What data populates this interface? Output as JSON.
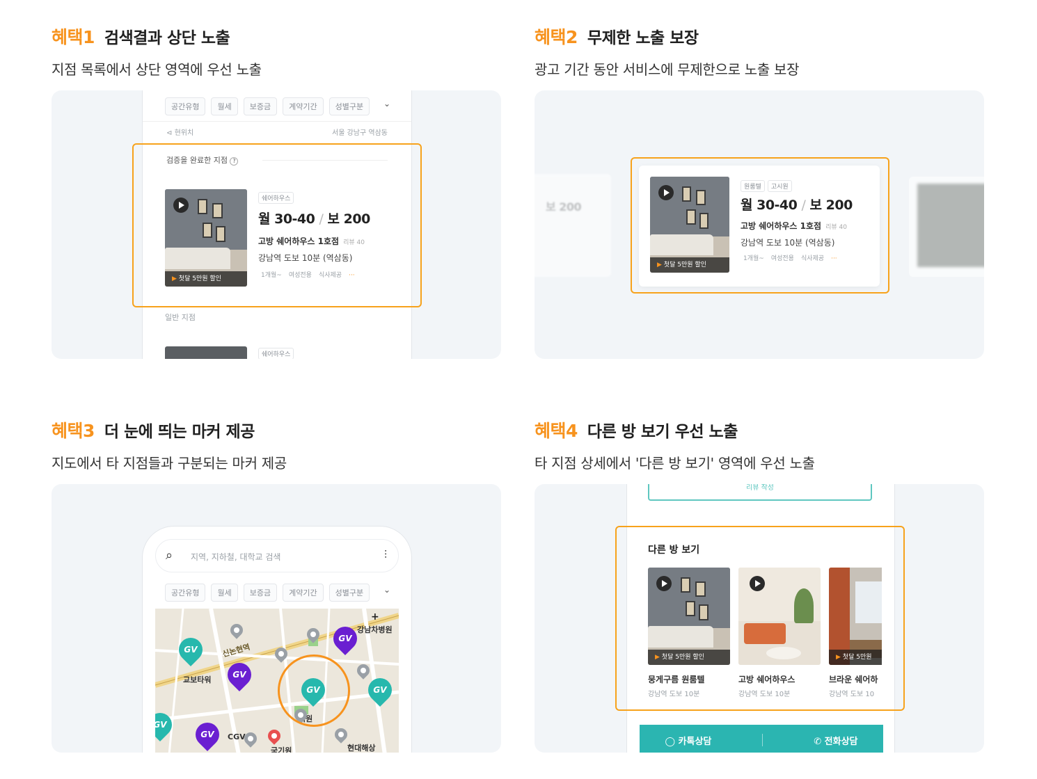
{
  "benefits": [
    {
      "tag": "혜택1",
      "title": "검색결과 상단 노출",
      "desc": "지점 목록에서 상단 영역에 우선 노출"
    },
    {
      "tag": "혜택2",
      "title": "무제한 노출 보장",
      "desc": "광고 기간 동안 서비스에 무제한으로 노출 보장"
    },
    {
      "tag": "혜택3",
      "title": "더 눈에 띄는 마커 제공",
      "desc": "지도에서 타 지점들과 구분되는 마커 제공"
    },
    {
      "tag": "혜택4",
      "title": "다른 방 보기 우선 노출",
      "desc": "타 지점 상세에서 '다른 방 보기' 영역에 우선 노출"
    }
  ],
  "filters": [
    "공간유형",
    "월세",
    "보증금",
    "계약기간",
    "성별구분"
  ],
  "mock_list": {
    "current_location": "현위치",
    "region": "서울 강남구 역삼동",
    "verified_section": "검증을 완료한 지점",
    "general_section": "일반 지점",
    "listing": {
      "badge": "쉐어하우스",
      "price_monthly": "월 30-40",
      "price_deposit": "보 200",
      "name": "고방 쉐어하우스 1호점",
      "reviews": "리뷰 40",
      "location": "강남역 도보 10분 (역삼동)",
      "options": [
        "1개월~",
        "여성전용",
        "식사제공"
      ],
      "promo": "첫달 5만원 할인"
    }
  },
  "mock_card2": {
    "badges": [
      "원룸텔",
      "고시원"
    ],
    "price_monthly": "월 30-40",
    "price_deposit": "보 200",
    "name": "고방 쉐어하우스 1호점",
    "reviews": "리뷰 40",
    "location": "강남역 도보 10분 (역삼동)",
    "options": [
      "1개월~",
      "여성전용",
      "식사제공"
    ],
    "promo": "첫달 5만원 할인",
    "side_price": "보 200"
  },
  "mock_map": {
    "search_placeholder": "지역, 지하철, 대학교 검색",
    "labels": [
      "신논현역",
      "교보타워",
      "강남차병원",
      "CGV",
      "기원",
      "현대해상",
      "국기원"
    ],
    "pin_text": "GV"
  },
  "mock_detail": {
    "review_button": "리뷰 작성",
    "section_title": "다른 방 보기",
    "rooms": [
      {
        "name": "뭉게구름 원룸텔",
        "sub": "강남역 도보 10분",
        "promo": "첫달 5만원 할인"
      },
      {
        "name": "고방 쉐어하우스",
        "sub": "강남역 도보 10분",
        "promo": ""
      },
      {
        "name": "브라운 쉐어하",
        "sub": "강남역 도보 10",
        "promo": "첫달 5만원"
      }
    ],
    "kakao_button": "카톡상담",
    "call_button": "전화상담"
  },
  "colors": {
    "accent": "#f7931e",
    "highlight": "#f7a21b",
    "teal": "#2bb5b1",
    "purple": "#6a1fd1",
    "card_bg": "#f2f5f8"
  }
}
